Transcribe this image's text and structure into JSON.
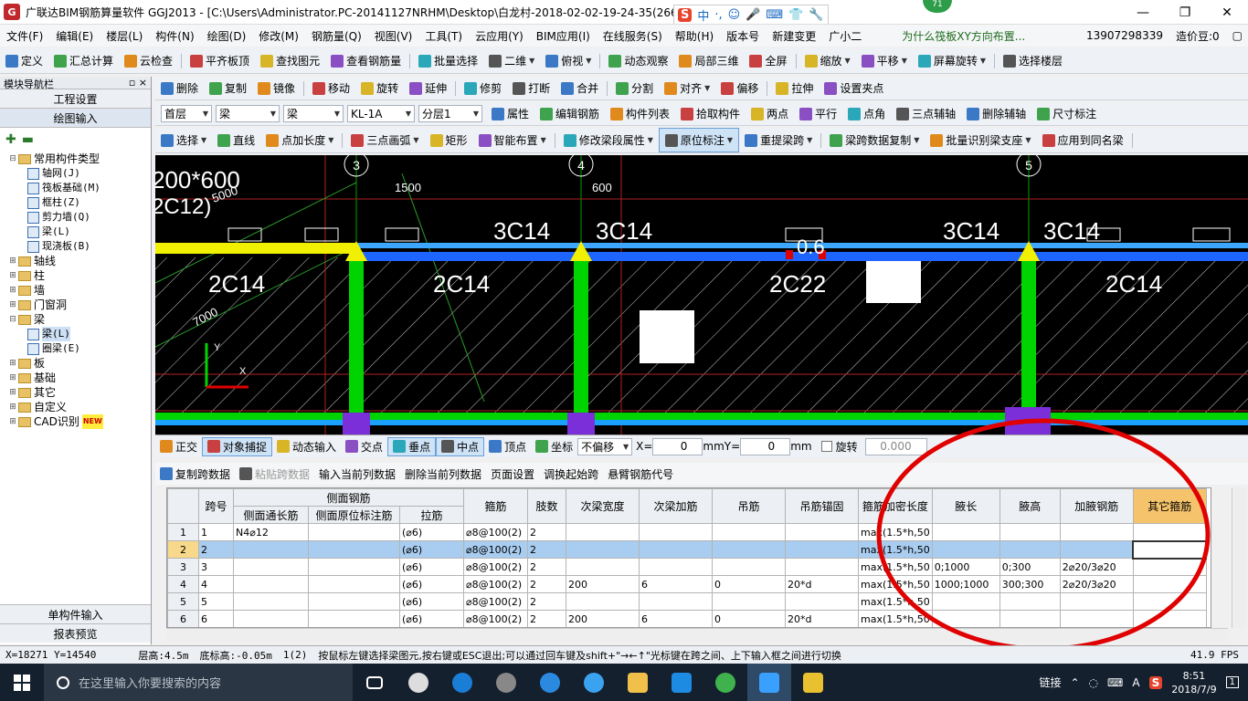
{
  "titlebar": {
    "title": "广联达BIM钢筋算量软件 GGJ2013 - [C:\\Users\\Administrator.PC-20141127NRHM\\Desktop\\白龙村-2018-02-02-19-24-35(2666版).GGJ12]",
    "badge": "71",
    "ime_labels": [
      "S",
      "中",
      "·,",
      "☺",
      "🎤",
      "⌨",
      "👕",
      "🔧"
    ]
  },
  "menubar": {
    "items": [
      "文件(F)",
      "编辑(E)",
      "楼层(L)",
      "构件(N)",
      "绘图(D)",
      "修改(M)",
      "钢筋量(Q)",
      "视图(V)",
      "工具(T)",
      "云应用(Y)",
      "BIM应用(I)",
      "在线服务(S)",
      "帮助(H)",
      "版本号",
      "新建变更",
      "广小二"
    ],
    "news": "为什么筏板XY方向布置...",
    "phone": "13907298339",
    "price": "造价豆:0"
  },
  "toolbar1": [
    "定义",
    "汇总计算",
    "云检查",
    "平齐板顶",
    "查找图元",
    "查看钢筋量",
    "批量选择",
    "二维",
    "俯视",
    "动态观察",
    "局部三维",
    "全屏",
    "缩放",
    "平移",
    "屏幕旋转",
    "选择楼层"
  ],
  "toolbar2": [
    "删除",
    "复制",
    "镜像",
    "移动",
    "旋转",
    "延伸",
    "修剪",
    "打断",
    "合并",
    "分割",
    "对齐",
    "偏移",
    "拉伸",
    "设置夹点"
  ],
  "toolbar3": {
    "floor": "首层",
    "category": "梁",
    "type": "梁",
    "name": "KL-1A",
    "layer": "分层1",
    "buttons": [
      "属性",
      "编辑钢筋",
      "构件列表",
      "拾取构件",
      "两点",
      "平行",
      "点角",
      "三点辅轴",
      "删除辅轴",
      "尺寸标注"
    ]
  },
  "toolbar4": [
    "选择",
    "直线",
    "点加长度",
    "三点画弧",
    "矩形",
    "智能布置",
    "修改梁段属性",
    "原位标注",
    "重提梁跨",
    "梁跨数据复制",
    "批量识别梁支座",
    "应用到同名梁"
  ],
  "panel": {
    "title": "模块导航栏",
    "pin": "▫ ×",
    "nav_engineering": "工程设置",
    "nav_drawing": "绘图输入",
    "tree": [
      {
        "label": "常用构件类型",
        "level": 0,
        "kind": "folder",
        "toggle": "⊟"
      },
      {
        "label": "轴网(J)",
        "level": 1,
        "kind": "item"
      },
      {
        "label": "筏板基础(M)",
        "level": 1,
        "kind": "item"
      },
      {
        "label": "框柱(Z)",
        "level": 1,
        "kind": "item"
      },
      {
        "label": "剪力墙(Q)",
        "level": 1,
        "kind": "item"
      },
      {
        "label": "梁(L)",
        "level": 1,
        "kind": "item"
      },
      {
        "label": "现浇板(B)",
        "level": 1,
        "kind": "item"
      },
      {
        "label": "轴线",
        "level": 0,
        "kind": "folder",
        "toggle": "⊞"
      },
      {
        "label": "柱",
        "level": 0,
        "kind": "folder",
        "toggle": "⊞"
      },
      {
        "label": "墙",
        "level": 0,
        "kind": "folder",
        "toggle": "⊞"
      },
      {
        "label": "门窗洞",
        "level": 0,
        "kind": "folder",
        "toggle": "⊞"
      },
      {
        "label": "梁",
        "level": 0,
        "kind": "folder",
        "toggle": "⊟"
      },
      {
        "label": "梁(L)",
        "level": 1,
        "kind": "item"
      },
      {
        "label": "圈梁(E)",
        "level": 1,
        "kind": "item"
      },
      {
        "label": "板",
        "level": 0,
        "kind": "folder",
        "toggle": "⊞"
      },
      {
        "label": "基础",
        "level": 0,
        "kind": "folder",
        "toggle": "⊞"
      },
      {
        "label": "其它",
        "level": 0,
        "kind": "folder",
        "toggle": "⊞"
      },
      {
        "label": "自定义",
        "level": 0,
        "kind": "folder",
        "toggle": "⊞"
      },
      {
        "label": "CAD识别",
        "level": 0,
        "kind": "folder",
        "toggle": "⊞"
      }
    ],
    "cad_new": "NEW",
    "bottom_single": "单构件输入",
    "bottom_report": "报表预览"
  },
  "canvas": {
    "top_left_text": "200*600",
    "top_left_text2": "2C12)",
    "dims": [
      "5000",
      "1500",
      "600",
      "7000"
    ],
    "axes": [
      "3",
      "4",
      "5"
    ],
    "top_labels": [
      "3C14",
      "3C14",
      "3C14",
      "3C14"
    ],
    "bottom_labels": [
      "2C14",
      "2C14",
      "2C22",
      "2C14"
    ],
    "small_label": "0.6"
  },
  "snapbar": {
    "items": [
      "正交",
      "对象捕捉",
      "动态输入",
      "交点",
      "垂点",
      "中点",
      "顶点",
      "坐标"
    ],
    "offset": "不偏移",
    "x_label": "X=",
    "x_value": "0",
    "y_label": "Y=",
    "y_value": "0",
    "unit": "mm",
    "rotate": "旋转",
    "rotate_value": "0.000"
  },
  "gridtb": [
    "复制跨数据",
    "粘贴跨数据",
    "输入当前列数据",
    "删除当前列数据",
    "页面设置",
    "调换起始跨",
    "悬臂钢筋代号"
  ],
  "grid": {
    "header_group": "侧面钢筋",
    "headers": [
      "跨号",
      "侧面通长筋",
      "侧面原位标注筋",
      "拉筋",
      "箍筋",
      "肢数",
      "次梁宽度",
      "次梁加筋",
      "吊筋",
      "吊筋锚固",
      "箍筋加密长度",
      "腋长",
      "腋高",
      "加腋钢筋",
      "其它箍筋"
    ],
    "rows": [
      [
        "1",
        "1",
        "N4⌀12",
        "",
        "(⌀6)",
        "⌀8@100(2)",
        "2",
        "",
        "",
        "",
        "",
        "max(1.5*h,50",
        "",
        "",
        "",
        ""
      ],
      [
        "2",
        "2",
        "",
        "",
        "(⌀6)",
        "⌀8@100(2)",
        "2",
        "",
        "",
        "",
        "",
        "max(1.5*h,50",
        "",
        "",
        "",
        ""
      ],
      [
        "3",
        "3",
        "",
        "",
        "(⌀6)",
        "⌀8@100(2)",
        "2",
        "",
        "",
        "",
        "",
        "max(1.5*h,50",
        "0;1000",
        "0;300",
        "2⌀20/3⌀20",
        ""
      ],
      [
        "4",
        "4",
        "",
        "",
        "(⌀6)",
        "⌀8@100(2)",
        "2",
        "200",
        "6",
        "0",
        "20*d",
        "max(1.5*h,50",
        "1000;1000",
        "300;300",
        "2⌀20/3⌀20",
        ""
      ],
      [
        "5",
        "5",
        "",
        "",
        "(⌀6)",
        "⌀8@100(2)",
        "2",
        "",
        "",
        "",
        "",
        "max(1.5*h,50",
        "",
        "",
        "",
        ""
      ],
      [
        "6",
        "6",
        "",
        "",
        "(⌀6)",
        "⌀8@100(2)",
        "2",
        "200",
        "6",
        "0",
        "20*d",
        "max(1.5*h,50",
        "",
        "",
        "",
        ""
      ]
    ]
  },
  "status": {
    "coords": "X=18271 Y=14540",
    "floor_height": "层高:4.5m",
    "bottom_elev": "底标高:-0.05m",
    "count": "1(2)",
    "hint": "按鼠标左键选择梁图元,按右键或ESC退出;可以通过回车键及shift+\"→←↑\"光标键在跨之间、上下输入框之间进行切换",
    "fps": "41.9 FPS"
  },
  "taskbar": {
    "search_placeholder": "在这里输入你要搜索的内容",
    "ime": "链接",
    "lang": "A",
    "time": "8:51",
    "date": "2018/7/9",
    "notify": "1"
  },
  "colors": {
    "beam_blue": "#1e64ff",
    "beam_yellow": "#f0f000",
    "column_green": "#00d400",
    "red_annotation": "#e00000"
  }
}
